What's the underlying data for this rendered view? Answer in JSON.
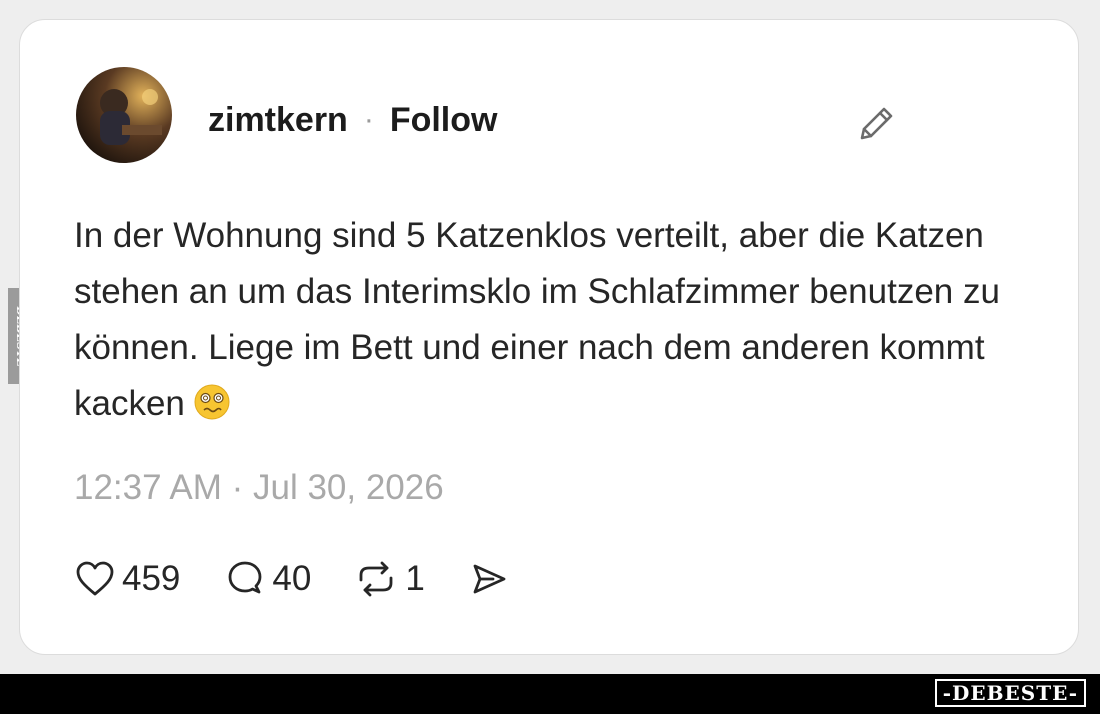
{
  "post": {
    "username": "zimtkern",
    "separator": "·",
    "follow_label": "Follow",
    "text": "In der Wohnung sind 5 Katzenklos verteilt, aber die Katzen stehen an um das Interimsklo im Schlafzimmer benutzen zu können. Liege im Bett und einer nach dem anderen kommt kacken",
    "emoji_name": "woozy-dizzy-face-emoji",
    "timestamp": "12:37 AM · Jul 30, 2026"
  },
  "actions": {
    "likes": "459",
    "comments": "40",
    "reposts": "1"
  },
  "icons": [
    "edit-pencil-icon",
    "heart-icon",
    "comment-bubble-icon",
    "repost-icon",
    "share-icon"
  ],
  "watermark": {
    "footer_brand": "-DEBESTE-",
    "side_brand": "DEBESTE"
  },
  "colors": {
    "card_bg": "#ffffff",
    "text": "#262626",
    "muted": "#a9a9a9",
    "footer_bg": "#000000"
  }
}
